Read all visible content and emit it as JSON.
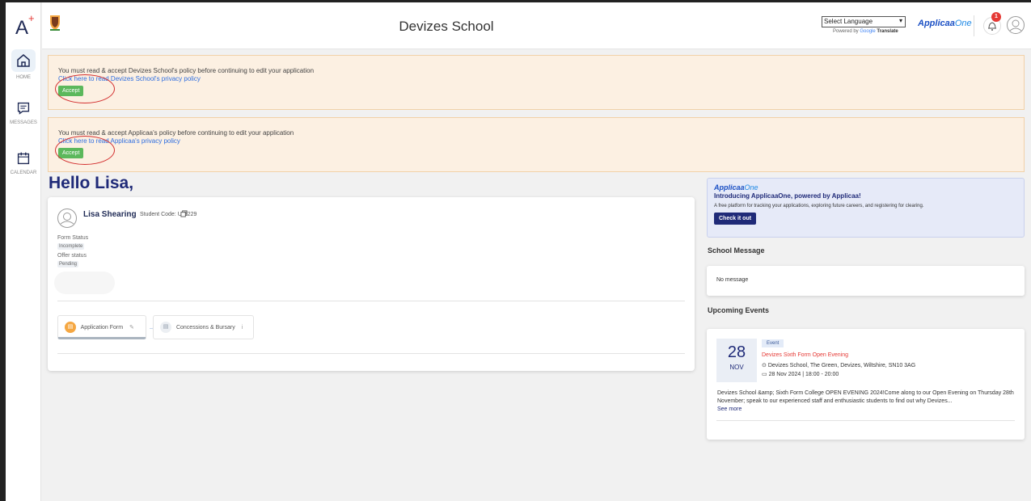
{
  "sidebar": {
    "logo": "A",
    "logo_plus": "+",
    "items": [
      {
        "label": "HOME",
        "icon": "home-icon"
      },
      {
        "label": "MESSAGES",
        "icon": "message-icon"
      },
      {
        "label": "CALENDAR",
        "icon": "calendar-icon"
      }
    ]
  },
  "header": {
    "title": "Devizes School",
    "language_select": "Select Language",
    "powered_prefix": "Powered by",
    "powered_google": "Google",
    "powered_translate": "Translate",
    "brand_a": "Applicaa",
    "brand_b": "One",
    "notification_count": "1"
  },
  "alerts": [
    {
      "text": "You must read & accept Devizes School's policy before continuing to edit your application",
      "link": "Click here to read Devizes School's privacy policy",
      "button": "Accept"
    },
    {
      "text": "You must read & accept Applicaa's policy before continuing to edit your application",
      "link": "Click here to read Applicaa's privacy policy",
      "button": "Accept"
    }
  ],
  "greeting": "Hello Lisa,",
  "profile": {
    "name": "Lisa Shearing",
    "student_code": "Student Code: U-B229",
    "form_status_label": "Form Status",
    "form_status": "Incomplete",
    "offer_status_label": "Offer status",
    "offer_status": "Pending",
    "steps": [
      {
        "label": "Application Form"
      },
      {
        "label": "Concessions & Bursary"
      }
    ]
  },
  "promo": {
    "brand_a": "Applicaa",
    "brand_b": "One",
    "title": "Introducing ApplicaaOne, powered by Applicaa!",
    "text": "A free platform for tracking your applications, exploring future careers, and registering for clearing.",
    "button": "Check it out"
  },
  "school_message": {
    "heading": "School Message",
    "text": "No message"
  },
  "events": {
    "heading": "Upcoming Events",
    "items": [
      {
        "day": "28",
        "month": "NOV",
        "tag": "Event",
        "title": "Devizes Sixth Form Open Evening",
        "location": "Devizes School, The Green, Devizes, Wiltshire, SN10 3AG",
        "datetime": "28 Nov 2024 | 18:00 - 20:00",
        "description": "Devizes School &amp; Sixth Form College OPEN EVENING 2024!Come along to our Open Evening on Thursday 28th November; speak to our experienced staff and enthusiastic students to find out why Devizes...",
        "see_more": "See more"
      }
    ]
  }
}
